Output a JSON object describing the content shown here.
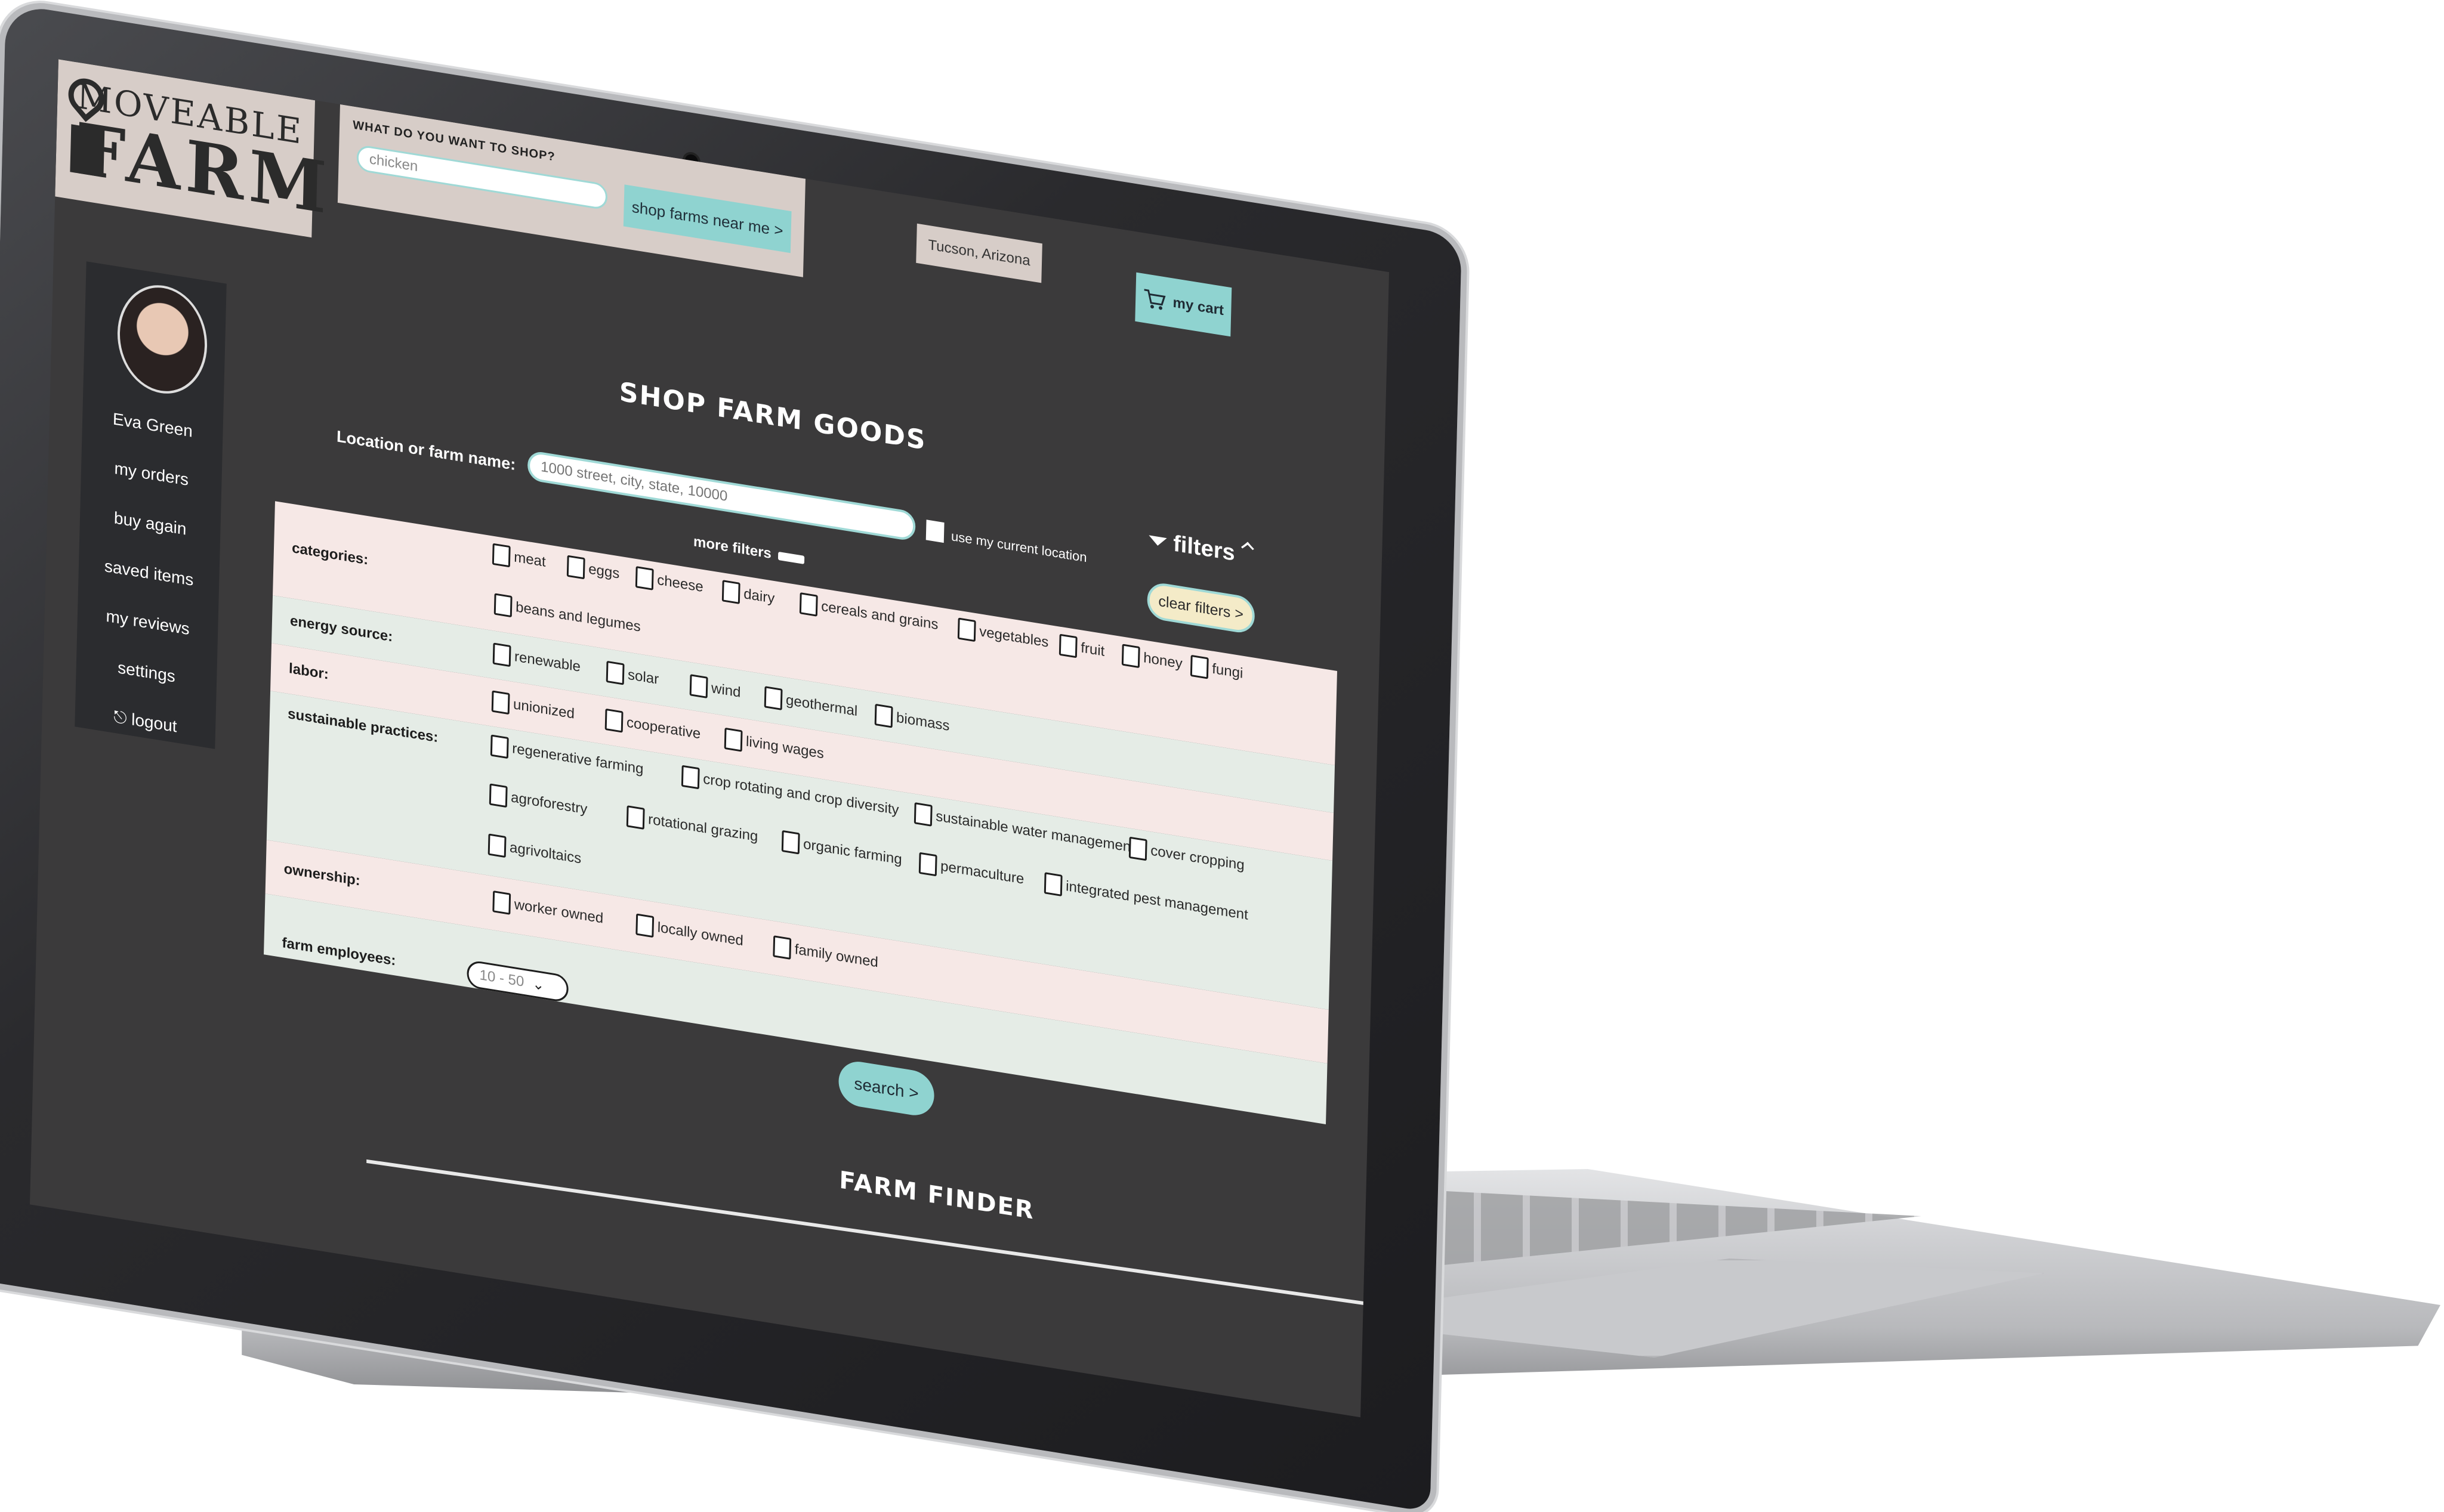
{
  "app": {
    "logo_line1": "MOVEABLE",
    "logo_line2": "FARM"
  },
  "header": {
    "shop_question": "WHAT DO YOU WANT TO SHOP?",
    "shop_input_value": "chicken",
    "shop_button": "shop farms near me >",
    "location": "Tucson, Arizona",
    "cart_label": "my cart"
  },
  "sidebar": {
    "user_name": "Eva Green",
    "items": [
      {
        "label": "my orders"
      },
      {
        "label": "buy again"
      },
      {
        "label": "saved items"
      },
      {
        "label": "my reviews"
      },
      {
        "label": "settings"
      },
      {
        "label": "logout"
      }
    ]
  },
  "main": {
    "title": "SHOP FARM GOODS",
    "location_label": "Location or farm name:",
    "location_placeholder": "1000 street, city, state, 10000",
    "use_location_label": "use my current location",
    "more_filters_label": "more filters",
    "filters_label": "filters",
    "clear_filters": "clear filters >",
    "search_button": "search >",
    "finder_title": "FARM FINDER"
  },
  "filters": {
    "categories": {
      "label": "categories:",
      "options": [
        "meat",
        "eggs",
        "cheese",
        "dairy",
        "cereals and grains",
        "vegetables",
        "fruit",
        "honey",
        "fungi",
        "beans and legumes"
      ]
    },
    "energy": {
      "label": "energy source:",
      "options": [
        "renewable",
        "solar",
        "wind",
        "geothermal",
        "biomass"
      ]
    },
    "labor": {
      "label": "labor:",
      "options": [
        "unionized",
        "cooperative",
        "living wages"
      ]
    },
    "sustainable": {
      "label": "sustainable practices:",
      "options": [
        "regenerative farming",
        "crop rotating and crop diversity",
        "sustainable water management",
        "cover cropping",
        "agroforestry",
        "rotational grazing",
        "organic farming",
        "permaculture",
        "integrated pest management",
        "agrivoltaics"
      ]
    },
    "ownership": {
      "label": "ownership:",
      "options": [
        "worker owned",
        "locally owned",
        "family owned"
      ]
    },
    "employees": {
      "label": "farm employees:",
      "selected": "10 - 50"
    }
  },
  "colors": {
    "accent": "#8fd3d0",
    "panel": "#d7cdc8",
    "screen_bg": "#3b3a3b",
    "row_pink": "#f6e8e6",
    "row_green": "#e5ece6"
  }
}
